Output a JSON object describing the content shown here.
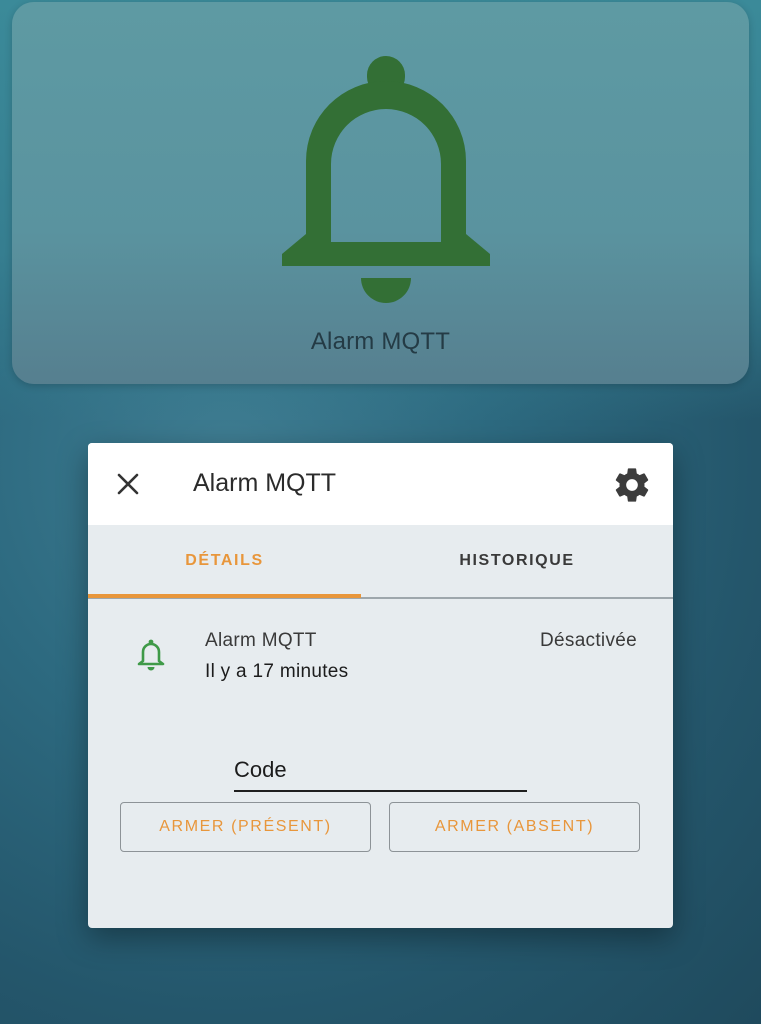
{
  "tile": {
    "label": "Alarm MQTT",
    "icon": "bell-icon",
    "icon_color": "#336f35"
  },
  "dialog": {
    "title": "Alarm MQTT",
    "close_icon": "close-icon",
    "settings_icon": "gear-icon",
    "tabs": [
      {
        "label": "DÉTAILS",
        "active": true
      },
      {
        "label": "HISTORIQUE",
        "active": false
      }
    ],
    "entity": {
      "icon": "bell-outline-icon",
      "icon_color": "#3f9a48",
      "name": "Alarm MQTT",
      "last_changed": "Il y a 17 minutes",
      "state": "Désactivée"
    },
    "code_input": {
      "placeholder": "Code",
      "value": ""
    },
    "buttons": {
      "arm_home": "ARMER (PRÉSENT)",
      "arm_away": "ARMER (ABSENT)"
    }
  },
  "colors": {
    "accent": "#e8963b",
    "dialog_background": "#e7ecef",
    "header_background": "#ffffff"
  }
}
